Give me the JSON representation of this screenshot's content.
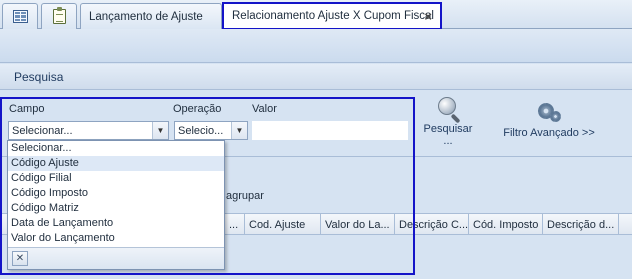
{
  "tabs": [
    {
      "type": "icon",
      "icon": "grid-icon"
    },
    {
      "type": "icon",
      "icon": "clipboard-icon"
    },
    {
      "type": "text",
      "label": "Lançamento de Ajuste"
    },
    {
      "type": "text",
      "label": "Relacionamento Ajuste X Cupom Fiscal",
      "active": true,
      "close": "×"
    }
  ],
  "search": {
    "section_title": "Pesquisa",
    "campo_label": "Campo",
    "campo_value": "Selecionar...",
    "operacao_label": "Operação",
    "operacao_value": "Selecio...",
    "valor_label": "Valor",
    "valor_value": "",
    "pesquisar_label_line1": "Pesquisar",
    "pesquisar_label_line2": "...",
    "filtro_label": "Filtro Avançado >>"
  },
  "dropdown": {
    "options": [
      "Selecionar...",
      "Código Ajuste",
      "Código Filial",
      "Código Imposto",
      "Código Matriz",
      "Data de Lançamento",
      "Valor do Lançamento"
    ],
    "hover_index": 1,
    "clear_button": "✕"
  },
  "group_panel": {
    "text": "agrupar"
  },
  "grid": {
    "columns": [
      "...",
      "Cod. Ajuste",
      "Valor do La...",
      "Descrição C...",
      "Cód. Imposto",
      "Descrição d..."
    ]
  },
  "colors": {
    "highlight_border": "#1414c8",
    "background": "#d6e3f2",
    "hover_row": "#dde8f6"
  }
}
